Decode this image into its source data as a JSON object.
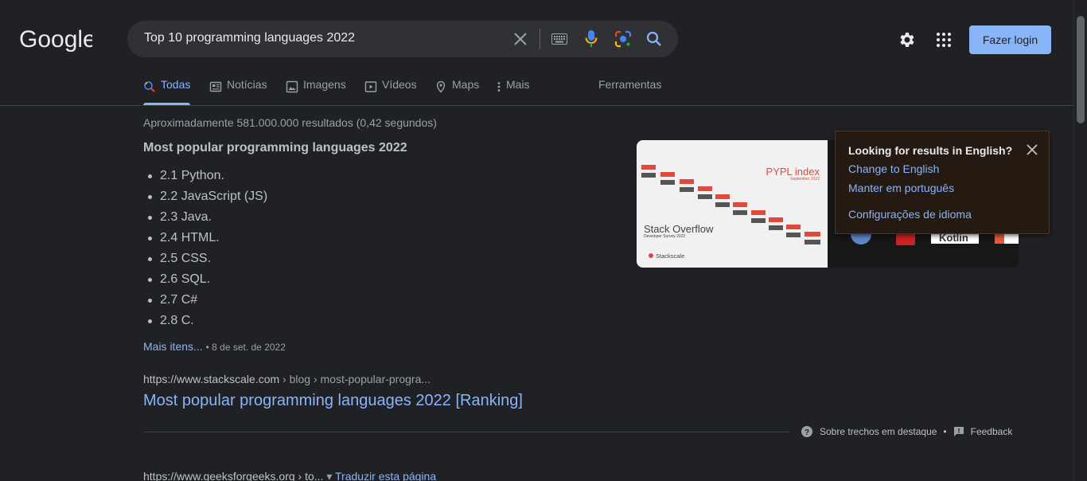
{
  "brand": {
    "logo_text": "Google"
  },
  "search": {
    "query": "Top 10 programming languages 2022"
  },
  "header": {
    "login_label": "Fazer login"
  },
  "tabs": [
    {
      "label": "Todas"
    },
    {
      "label": "Notícias"
    },
    {
      "label": "Imagens"
    },
    {
      "label": "Vídeos"
    },
    {
      "label": "Maps"
    },
    {
      "label": "Mais"
    },
    {
      "label": "Ferramentas"
    }
  ],
  "results": {
    "stats": "Aproximadamente 581.000.000 resultados (0,42 segundos)",
    "featured": {
      "title": "Most popular programming languages 2022",
      "items": [
        "2.1 Python.",
        "2.2 JavaScript (JS)",
        "2.3 Java.",
        "2.4 HTML.",
        "2.5 CSS.",
        "2.6 SQL.",
        "2.7 C#",
        "2.8 C."
      ],
      "more_label": "Mais itens...",
      "date": "8 de set. de 2022",
      "url_domain": "https://www.stackscale.com",
      "url_path": " › blog › most-popular-progra...",
      "link_title": "Most popular programming languages 2022 [Ranking]",
      "about_label": "Sobre trechos em destaque",
      "feedback_label": "Feedback"
    },
    "next": {
      "url_domain": "https://www.geeksforgeeks.org",
      "url_path": " › to...",
      "translate_label": "Traduzir esta página"
    }
  },
  "image": {
    "pypl_title": "PYPL index",
    "pypl_sub": "September 2022",
    "so_title": "Stack Overflow",
    "so_sub": "Developer Survey 2022",
    "brand": "Stackscale",
    "kotlin": "Kotlin"
  },
  "popup": {
    "title": "Looking for results in English?",
    "change_label": "Change to English",
    "keep_label": "Manter em português",
    "settings_label": "Configurações de idioma"
  }
}
